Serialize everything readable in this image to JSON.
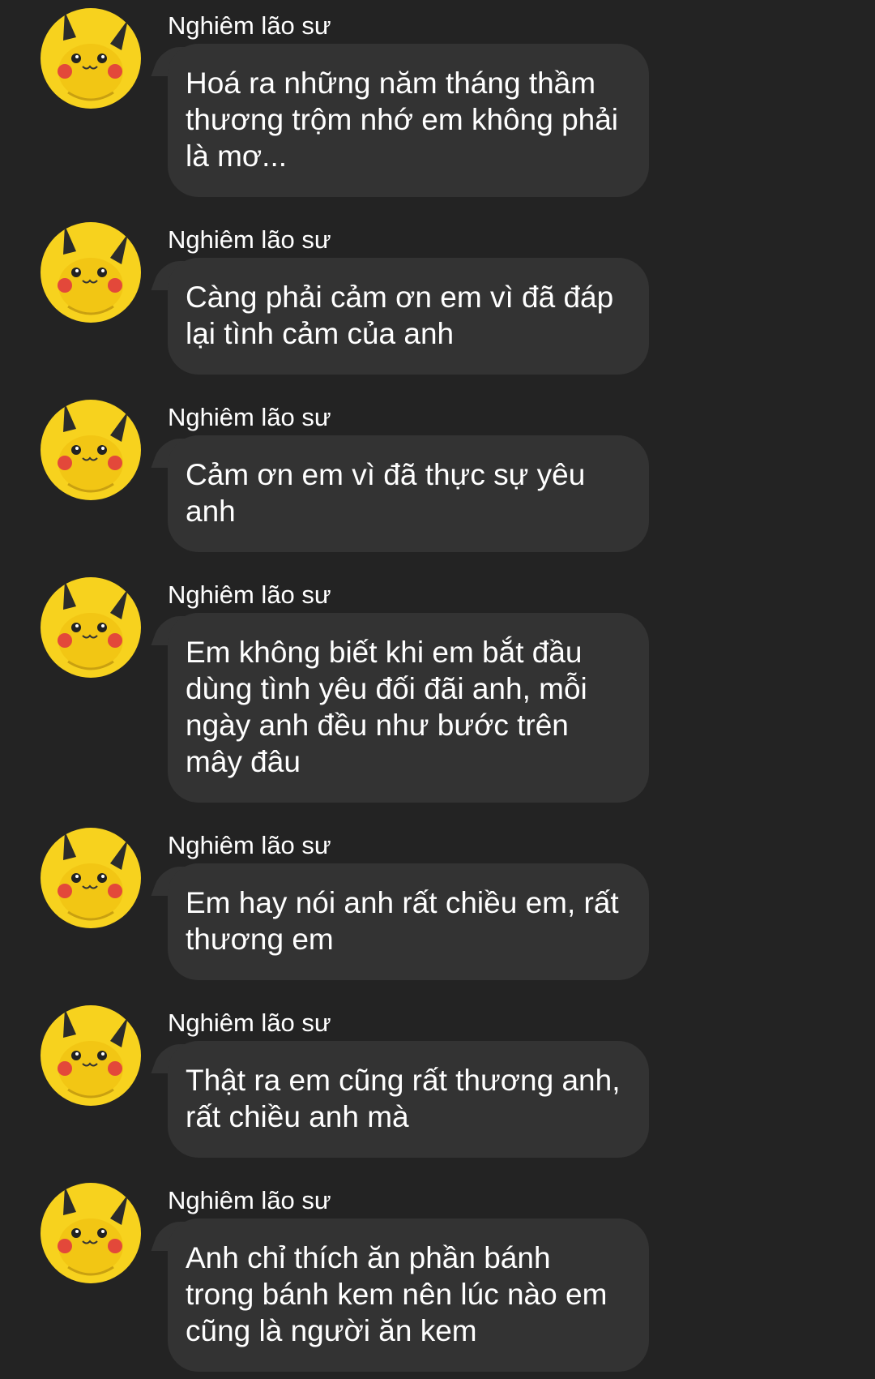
{
  "sender": "Nghiêm lão sư",
  "avatar_icon": "pikachu-avatar-icon",
  "colors": {
    "background": "#232323",
    "bubble": "#333333",
    "text": "#ffffff",
    "avatar": "#f7d21e"
  },
  "messages": [
    {
      "text": "Hoá ra những năm tháng thầm\nthương trộm nhớ em không phải\nlà mơ..."
    },
    {
      "text": "Càng phải cảm ơn em vì đã đáp\nlại tình cảm của anh"
    },
    {
      "text": "Cảm ơn em vì đã thực sự yêu\nanh"
    },
    {
      "text": "Em không biết khi em bắt đầu\ndùng tình yêu đối đãi anh, mỗi\nngày anh đều như bước trên\nmây đâu"
    },
    {
      "text": "Em hay nói anh rất chiều em, rất\nthương em"
    },
    {
      "text": "Thật ra em cũng rất thương anh,\nrất chiều anh mà"
    },
    {
      "text": "Anh chỉ thích ăn phần bánh\ntrong bánh kem nên lúc nào em\ncũng là người ăn kem"
    }
  ]
}
